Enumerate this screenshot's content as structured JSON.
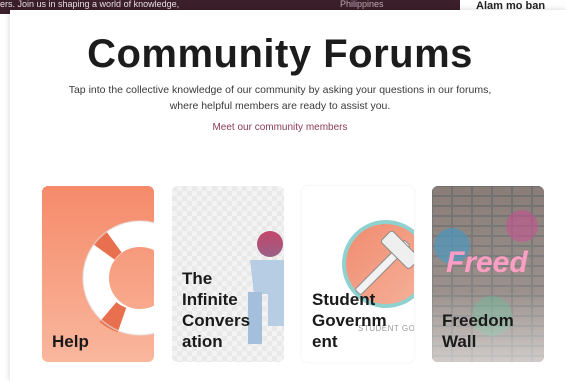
{
  "background": {
    "banner_left": "ers. Join us in shaping a world of knowledge,",
    "banner_right": "Philippines",
    "right_peek": "Alam mo ban"
  },
  "modal": {
    "title": "Community Forums",
    "subtitle_line1": "Tap into the collective knowledge of our community by asking your questions in our forums,",
    "subtitle_line2": "where helpful members are ready to assist you.",
    "members_link": "Meet our community members"
  },
  "cards": [
    {
      "label": "Help",
      "icon": "lifebuoy-icon",
      "color": "#f58a6a"
    },
    {
      "label": "The Infinite Conversation",
      "label_lines": [
        "The",
        "Infinite",
        "Convers",
        "ation"
      ],
      "icon": "person-icon"
    },
    {
      "label": "Student Government",
      "label_lines": [
        "Student",
        "Governm",
        "ent"
      ],
      "icon": "gavel-icon",
      "art_text": "STUDENT GOVER"
    },
    {
      "label": "Freedom Wall",
      "label_lines": [
        "Freedom",
        "Wall"
      ],
      "icon": "graffiti-wall-icon",
      "art_text": "Freed"
    }
  ]
}
